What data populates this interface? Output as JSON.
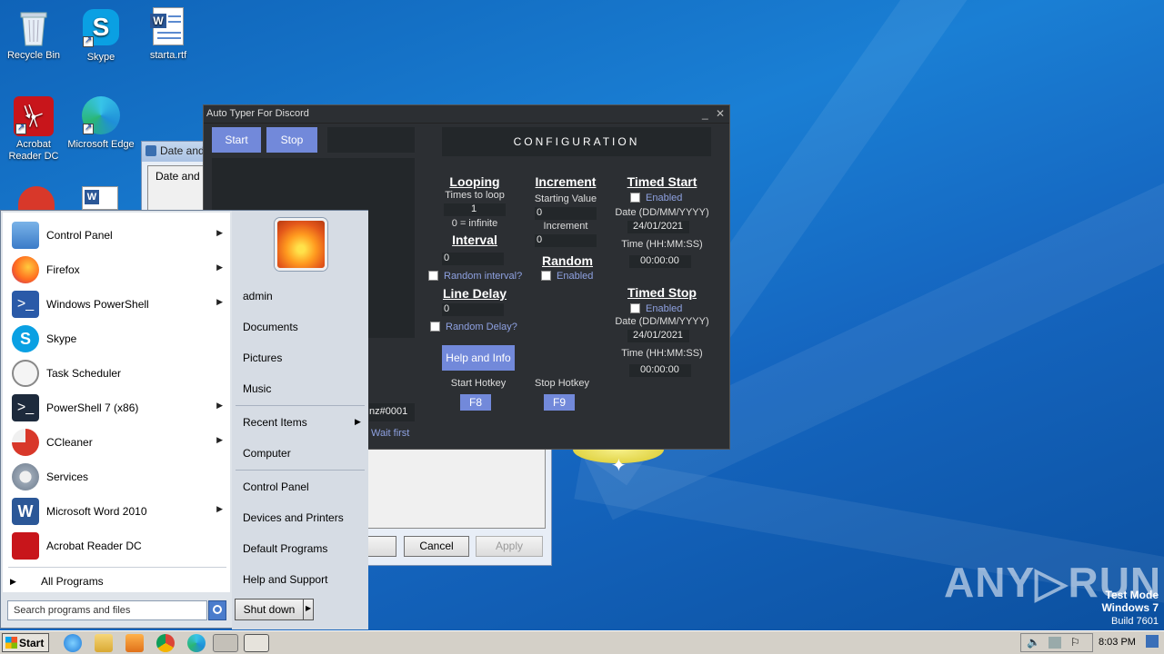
{
  "desktop": {
    "icons": [
      {
        "label": "Recycle Bin"
      },
      {
        "label": "Skype"
      },
      {
        "label": "starta.rtf"
      },
      {
        "label": "Acrobat Reader DC"
      },
      {
        "label": "Microsoft Edge"
      }
    ]
  },
  "bg_dialog": {
    "title": "Date and T",
    "tab": "Date and T",
    "cancel_label": "Cancel",
    "apply_label": "Apply",
    "partial_text": "nz#0001",
    "partial_wait": "Wait first"
  },
  "autotyper": {
    "title": "Auto Typer For Discord",
    "minimize": "_",
    "close": "✕",
    "start_label": "Start",
    "stop_label": "Stop",
    "config_label": "CONFIGURATION",
    "looping": {
      "header": "Looping",
      "times_label": "Times to loop",
      "times_value": "1",
      "infinite_note": "0 = infinite"
    },
    "interval": {
      "header": "Interval",
      "value": "0",
      "random_label": "Random interval?"
    },
    "line_delay": {
      "header": "Line Delay",
      "value": "0",
      "random_label": "Random Delay?"
    },
    "increment": {
      "header": "Increment",
      "starting_label": "Starting Value",
      "starting_value": "0",
      "increment_label": "Increment",
      "increment_value": "0"
    },
    "random": {
      "header": "Random",
      "enabled_label": "Enabled"
    },
    "timed_start": {
      "header": "Timed Start",
      "enabled_label": "Enabled",
      "date_label": "Date (DD/MM/YYYY)",
      "date_value": "24/01/2021",
      "time_label": "Time (HH:MM:SS)",
      "time_value": "00:00:00"
    },
    "timed_stop": {
      "header": "Timed Stop",
      "enabled_label": "Enabled",
      "date_label": "Date (DD/MM/YYYY)",
      "date_value": "24/01/2021",
      "time_label": "Time (HH:MM:SS)",
      "time_value": "00:00:00"
    },
    "help_label": "Help and Info",
    "start_hotkey_label": "Start Hotkey",
    "start_hotkey_value": "F8",
    "stop_hotkey_label": "Stop Hotkey",
    "stop_hotkey_value": "F9"
  },
  "start_menu": {
    "programs": [
      {
        "label": "Control Panel",
        "submenu": true
      },
      {
        "label": "Firefox",
        "submenu": true
      },
      {
        "label": "Windows PowerShell",
        "submenu": true
      },
      {
        "label": "Skype",
        "submenu": false
      },
      {
        "label": "Task Scheduler",
        "submenu": false
      },
      {
        "label": "PowerShell 7 (x86)",
        "submenu": true
      },
      {
        "label": "CCleaner",
        "submenu": true
      },
      {
        "label": "Services",
        "submenu": false
      },
      {
        "label": "Microsoft Word 2010",
        "submenu": true
      },
      {
        "label": "Acrobat Reader DC",
        "submenu": false
      }
    ],
    "all_programs": "All Programs",
    "search_placeholder": "Search programs and files",
    "right_items": {
      "user": "admin",
      "documents": "Documents",
      "pictures": "Pictures",
      "music": "Music",
      "recent": "Recent Items",
      "computer": "Computer",
      "control_panel": "Control Panel",
      "devices": "Devices and Printers",
      "defaults": "Default Programs",
      "help": "Help and Support"
    },
    "shutdown_label": "Shut down"
  },
  "taskbar": {
    "start_label": "Start",
    "clock": "8:03 PM"
  },
  "watermark": {
    "brand": "ANY▷RUN",
    "mode": "Test Mode",
    "os": "Windows 7",
    "build": "Build 7601"
  }
}
